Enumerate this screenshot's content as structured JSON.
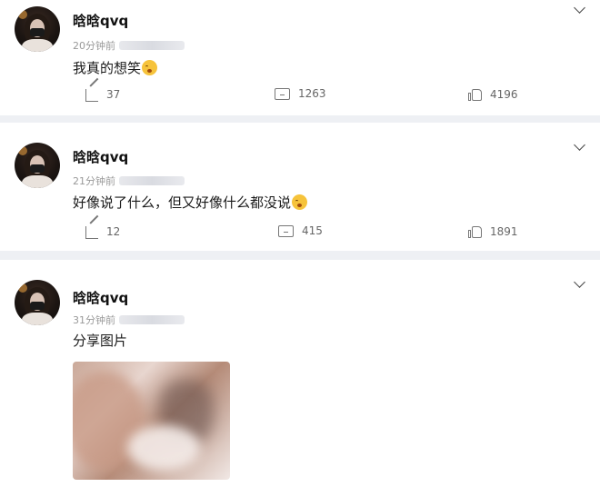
{
  "posts": [
    {
      "username": "晗晗qvq",
      "time": "20分钟前",
      "text": "我真的想笑",
      "reposts": "37",
      "comments": "1263",
      "likes": "4196"
    },
    {
      "username": "晗晗qvq",
      "time": "21分钟前",
      "text": "好像说了什么，但又好像什么都没说",
      "reposts": "12",
      "comments": "415",
      "likes": "1891"
    },
    {
      "username": "晗晗qvq",
      "time": "31分钟前",
      "text": "分享图片"
    }
  ],
  "icons": {
    "emoji": "laughing-emoji-icon",
    "repost": "repost-icon",
    "comment": "comment-icon",
    "like": "thumbs-up-icon",
    "menu": "chevron-down-icon"
  },
  "colors": {
    "page_background": "#eef0f4",
    "card_background": "#ffffff",
    "meta_text": "#999999",
    "action_text": "#666666"
  }
}
